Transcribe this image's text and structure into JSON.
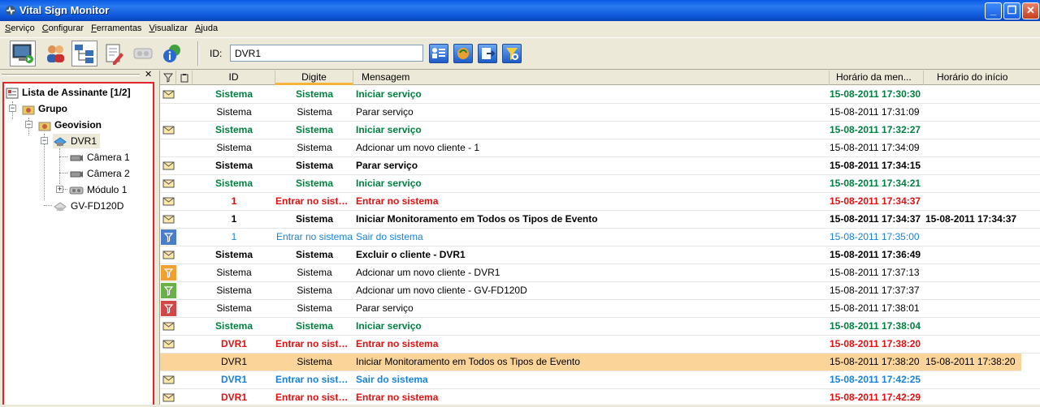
{
  "window": {
    "title": "Vital Sign Monitor"
  },
  "menu": [
    "Serviço",
    "Configurar",
    "Ferramentas",
    "Visualizar",
    "Ajuda"
  ],
  "toolbar": {
    "id_label": "ID:",
    "id_value": "DVR1",
    "buttons": [
      "monitor-icon",
      "users-icon",
      "network-tree-icon",
      "edit-document-icon",
      "camera-device-icon",
      "info-globe-icon"
    ],
    "search_buttons": [
      "user-list-icon",
      "refresh-globe-icon",
      "export-icon",
      "search-filter-icon"
    ]
  },
  "tree": {
    "root": "Lista de Assinante [1/2]",
    "group": "Grupo",
    "subgroup": "Geovision",
    "dvr": "DVR1",
    "camera1": "Câmera 1",
    "camera2": "Câmera 2",
    "module": "Módulo 1",
    "device": "GV-FD120D"
  },
  "grid": {
    "headers": {
      "id": "ID",
      "digite": "Digite",
      "mensagem": "Mensagem",
      "horario_msg": "Horário da men...",
      "horario_inicio": "Horário do início"
    },
    "rows": [
      {
        "icon": "envelope",
        "style": "green",
        "id": "Sistema",
        "digite": "Sistema",
        "msg": "Iniciar serviço",
        "t1": "15-08-2011 17:30:30",
        "t2": ""
      },
      {
        "icon": "none",
        "style": "black",
        "id": "Sistema",
        "digite": "Sistema",
        "msg": "Parar serviço",
        "t1": "15-08-2011 17:31:09",
        "t2": ""
      },
      {
        "icon": "envelope",
        "style": "green",
        "id": "Sistema",
        "digite": "Sistema",
        "msg": "Iniciar serviço",
        "t1": "15-08-2011 17:32:27",
        "t2": ""
      },
      {
        "icon": "none",
        "style": "black",
        "id": "Sistema",
        "digite": "Sistema",
        "msg": "Adcionar um novo cliente - 1",
        "t1": "15-08-2011 17:34:09",
        "t2": ""
      },
      {
        "icon": "envelope",
        "style": "bold",
        "id": "Sistema",
        "digite": "Sistema",
        "msg": "Parar serviço",
        "t1": "15-08-2011 17:34:15",
        "t2": ""
      },
      {
        "icon": "envelope",
        "style": "green",
        "id": "Sistema",
        "digite": "Sistema",
        "msg": "Iniciar serviço",
        "t1": "15-08-2011 17:34:21",
        "t2": ""
      },
      {
        "icon": "envelope",
        "style": "red",
        "id": "1",
        "digite": "Entrar no sistema",
        "msg": "Entrar no sistema",
        "t1": "15-08-2011 17:34:37",
        "t2": ""
      },
      {
        "icon": "envelope",
        "style": "bold",
        "id": "1",
        "digite": "Sistema",
        "msg": "Iniciar Monitoramento em Todos os Tipos de Evento",
        "t1": "15-08-2011 17:34:37",
        "t2": "15-08-2011 17:34:37"
      },
      {
        "icon": "flag-blue",
        "style": "blue",
        "id": "1",
        "digite": "Entrar no sistema",
        "msg": "Sair do sistema",
        "t1": "15-08-2011 17:35:00",
        "t2": ""
      },
      {
        "icon": "envelope",
        "style": "bold",
        "id": "Sistema",
        "digite": "Sistema",
        "msg": "Excluir o cliente - DVR1",
        "t1": "15-08-2011 17:36:49",
        "t2": ""
      },
      {
        "icon": "flag-orange",
        "style": "black",
        "id": "Sistema",
        "digite": "Sistema",
        "msg": "Adcionar um novo cliente - DVR1",
        "t1": "15-08-2011 17:37:13",
        "t2": ""
      },
      {
        "icon": "flag-green",
        "style": "black",
        "id": "Sistema",
        "digite": "Sistema",
        "msg": "Adcionar um novo cliente - GV-FD120D",
        "t1": "15-08-2011 17:37:37",
        "t2": ""
      },
      {
        "icon": "flag-red",
        "style": "black",
        "id": "Sistema",
        "digite": "Sistema",
        "msg": "Parar serviço",
        "t1": "15-08-2011 17:38:01",
        "t2": ""
      },
      {
        "icon": "envelope",
        "style": "green",
        "id": "Sistema",
        "digite": "Sistema",
        "msg": "Iniciar serviço",
        "t1": "15-08-2011 17:38:04",
        "t2": ""
      },
      {
        "icon": "envelope",
        "style": "red",
        "id": "DVR1",
        "digite": "Entrar no sistema",
        "msg": "Entrar no sistema",
        "t1": "15-08-2011 17:38:20",
        "t2": ""
      },
      {
        "icon": "none",
        "style": "black",
        "selected": true,
        "id": "DVR1",
        "digite": "Sistema",
        "msg": "Iniciar Monitoramento em Todos os Tipos de Evento",
        "t1": "15-08-2011 17:38:20",
        "t2": "15-08-2011 17:38:20"
      },
      {
        "icon": "envelope",
        "style": "blueb",
        "id": "DVR1",
        "digite": "Entrar no sistema",
        "msg": "Sair do sistema",
        "t1": "15-08-2011 17:42:25",
        "t2": ""
      },
      {
        "icon": "envelope",
        "style": "red",
        "id": "DVR1",
        "digite": "Entrar no sistema",
        "msg": "Entrar no sistema",
        "t1": "15-08-2011 17:42:29",
        "t2": ""
      }
    ]
  },
  "colors": {
    "accent_sorted": "#f8b33a",
    "selected_row": "#fbd49a",
    "green": "#008040",
    "red": "#e01010",
    "blue": "#1882d8",
    "tree_border": "#e0242a"
  }
}
